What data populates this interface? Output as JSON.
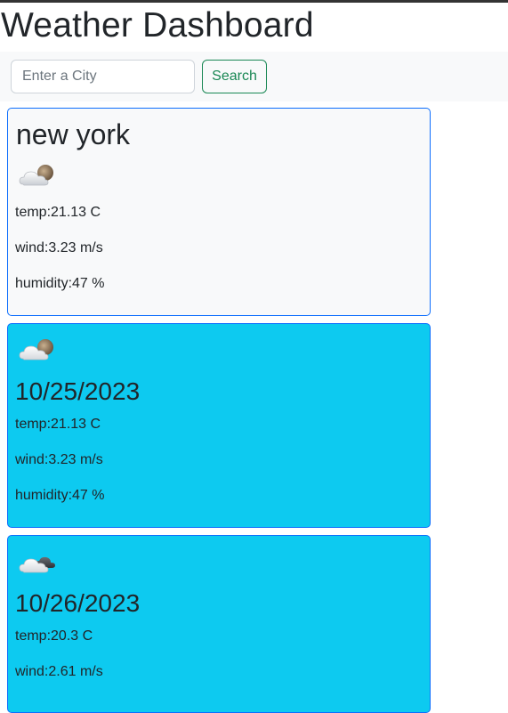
{
  "page": {
    "title": "Weather Dashboard"
  },
  "search": {
    "placeholder": "Enter a City",
    "value": "",
    "button_label": "Search"
  },
  "current": {
    "city": "new york",
    "icon": "partly-cloudy-night-icon",
    "temp": "temp:21.13 C",
    "wind": "wind:3.23 m/s",
    "humidity": "humidity:47 %"
  },
  "forecast": [
    {
      "date": "10/25/2023",
      "icon": "partly-cloudy-night-icon",
      "temp": "temp:21.13 C",
      "wind": "wind:3.23 m/s",
      "humidity": "humidity:47 %"
    },
    {
      "date": "10/26/2023",
      "icon": "cloudy-night-icon",
      "temp": "temp:20.3 C",
      "wind": "wind:2.61 m/s"
    }
  ],
  "colors": {
    "forecast_card_bg": "#0dcaf0",
    "card_border": "#0d6efd",
    "search_button": "#198754",
    "search_bar_bg": "#f8f9fa"
  }
}
